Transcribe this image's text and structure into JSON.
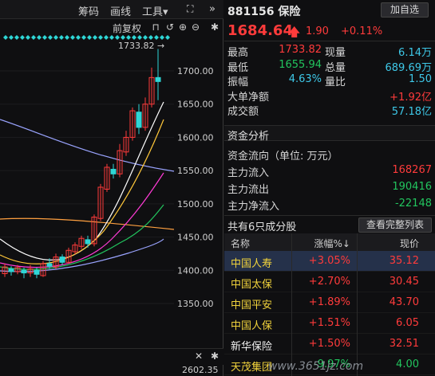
{
  "toolbar": {
    "items": [
      "筹码",
      "画线",
      "工具▾"
    ],
    "fuquan": "前复权"
  },
  "chart": {
    "max_label": "1733.82",
    "y_labels": [
      "1700.00",
      "1650.00",
      "1600.00",
      "1550.00",
      "1500.00",
      "1450.00",
      "1400.00",
      "1350.00"
    ],
    "bottom_value": "2602.35",
    "colors": {
      "up": "#ff3b3b",
      "down": "#2ed6d6",
      "ma1": "#ffffff",
      "ma2": "#ffc83a",
      "ma3": "#ff3bd6",
      "ma4": "#22c55e",
      "ma5": "#9aa4ff",
      "ma6": "#ffa040"
    }
  },
  "quote": {
    "code": "881156",
    "name": "保险",
    "add_btn": "加自选",
    "price": "1684.64",
    "change": "1.90",
    "change_pct": "+0.11%"
  },
  "stats": [
    {
      "l1": "最高",
      "v1": "1733.82",
      "c1": "red",
      "l2": "现量",
      "v2": "6.14万",
      "c2": "cyan"
    },
    {
      "l1": "最低",
      "v1": "1655.94",
      "c1": "green",
      "l2": "总量",
      "v2": "689.69万",
      "c2": "cyan"
    },
    {
      "l1": "振幅",
      "v1": "4.63%",
      "c1": "cyan",
      "l2": "量比",
      "v2": "1.50",
      "c2": "cyan"
    },
    {
      "l1": "大单净额",
      "v1": "",
      "c1": "",
      "l2": "",
      "v2": "+1.92亿",
      "c2": "red"
    },
    {
      "l1": "成交额",
      "v1": "",
      "c1": "",
      "l2": "",
      "v2": "57.18亿",
      "c2": "cyan"
    }
  ],
  "fund": {
    "title": "资金分析",
    "rows": [
      {
        "label": "资金流向（单位: 万元）",
        "value": "",
        "cls": ""
      },
      {
        "label": "主力流入",
        "value": "168267",
        "cls": "red"
      },
      {
        "label": "主力流出",
        "value": "190416",
        "cls": "green"
      },
      {
        "label": "主力净流入",
        "value": "-22148",
        "cls": "green"
      }
    ]
  },
  "components": {
    "title": "共有6只成分股",
    "view_btn": "查看完整列表",
    "headers": {
      "name": "名称",
      "chg": "涨幅%↓",
      "px": "现价"
    },
    "rows": [
      {
        "name": "中国人寿",
        "chg": "+3.05%",
        "px": "35.12",
        "cls": "red"
      },
      {
        "name": "中国太保",
        "chg": "+2.70%",
        "px": "30.45",
        "cls": "red"
      },
      {
        "name": "中国平安",
        "chg": "+1.89%",
        "px": "43.70",
        "cls": "red"
      },
      {
        "name": "中国人保",
        "chg": "+1.51%",
        "px": "6.05",
        "cls": "red"
      },
      {
        "name": "新华保险",
        "chg": "+1.50%",
        "px": "32.51",
        "cls": "red"
      },
      {
        "name": "天茂集团",
        "chg": "-9.97%",
        "px": "4.00",
        "cls": "green"
      }
    ]
  },
  "watermark": "www.3651jz.com"
}
